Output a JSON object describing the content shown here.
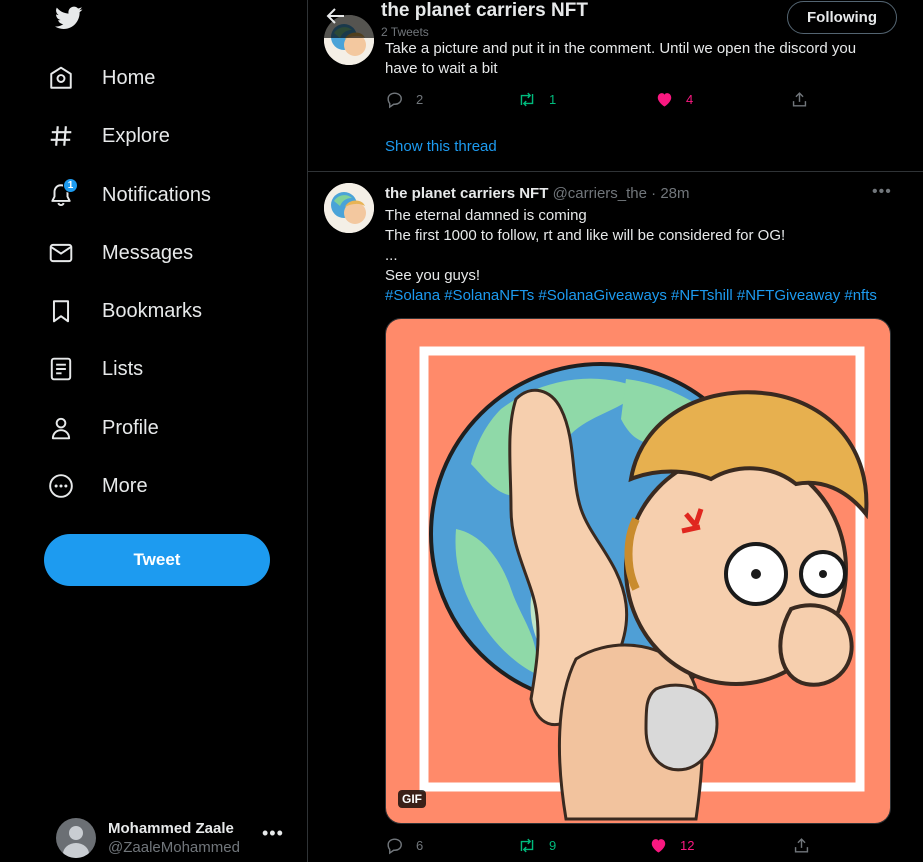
{
  "sidebar": {
    "logo": "twitter-bird-icon",
    "items": [
      {
        "label": "Home",
        "icon": "home-icon"
      },
      {
        "label": "Explore",
        "icon": "hashtag-icon"
      },
      {
        "label": "Notifications",
        "icon": "bell-icon",
        "badge": "1"
      },
      {
        "label": "Messages",
        "icon": "envelope-icon"
      },
      {
        "label": "Bookmarks",
        "icon": "bookmark-icon"
      },
      {
        "label": "Lists",
        "icon": "list-icon"
      },
      {
        "label": "Profile",
        "icon": "person-icon"
      },
      {
        "label": "More",
        "icon": "more-circle-icon"
      }
    ],
    "tweet_button": "Tweet",
    "account": {
      "name": "Mohammed Zaale",
      "handle": "@ZaaleMohammed"
    }
  },
  "header": {
    "title": "the planet carriers NFT",
    "subtitle": "2 Tweets",
    "follow_label": "Following"
  },
  "tweet1": {
    "text_line1": "Take a picture and put it in the comment. Until we open the discord you",
    "text_line2": "have to wait a bit",
    "replies": "2",
    "retweets": "1",
    "likes": "4",
    "show_thread": "Show this thread"
  },
  "tweet2": {
    "name": "the planet carriers NFT",
    "handle": "@carriers_the",
    "separator": "·",
    "time": "28m",
    "lines": [
      "The eternal damned is coming",
      "The first 1000 to follow, rt and like will be considered for OG!",
      "...",
      "See you guys!"
    ],
    "hashtags": "#Solana #SolanaNFTs #SolanaGiveaways #NFTshill #NFTGiveaway #nfts",
    "media_badge": "GIF",
    "replies": "6",
    "retweets": "9",
    "likes": "12"
  },
  "colors": {
    "accent": "#1d9bf0",
    "retweet": "#00ba7c",
    "like": "#f91880",
    "media_background": "#ff8a6a"
  }
}
